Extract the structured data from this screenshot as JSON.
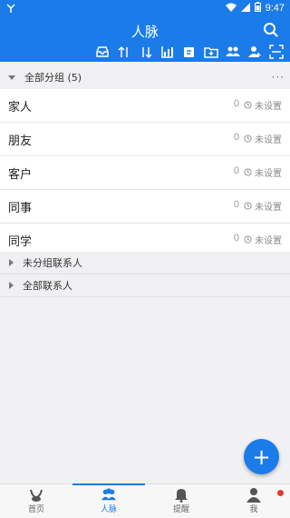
{
  "status_bar": {
    "time": "9:47",
    "signal_icon": "signal-icon",
    "wifi_icon": "wifi-icon",
    "battery_icon": "battery-icon"
  },
  "appbar": {
    "title": "人脉"
  },
  "tools": [
    {
      "name": "inbox-tool-icon"
    },
    {
      "name": "sort-up-tool-icon"
    },
    {
      "name": "sort-down-tool-icon"
    },
    {
      "name": "chart-tool-icon"
    },
    {
      "name": "edit-tool-icon"
    },
    {
      "name": "new-folder-tool-icon"
    },
    {
      "name": "group-tool-icon"
    },
    {
      "name": "add-contact-tool-icon"
    },
    {
      "name": "scan-tool-icon"
    }
  ],
  "group_header": {
    "label": "全部分组 (5)",
    "more": "···"
  },
  "groups": [
    {
      "name": "家人",
      "count": "0",
      "status": "未设置"
    },
    {
      "name": "朋友",
      "count": "0",
      "status": "未设置"
    },
    {
      "name": "客户",
      "count": "0",
      "status": "未设置"
    },
    {
      "name": "同事",
      "count": "0",
      "status": "未设置"
    },
    {
      "name": "同学",
      "count": "0",
      "status": "未设置"
    }
  ],
  "sections": [
    {
      "label": "未分组联系人"
    },
    {
      "label": "全部联系人"
    }
  ],
  "fab": {
    "label": "+"
  },
  "tabs": [
    {
      "label": "首页"
    },
    {
      "label": "人脉"
    },
    {
      "label": "提醒"
    },
    {
      "label": "我"
    }
  ],
  "colors": {
    "primary": "#1b7be8",
    "badge": "#e53935"
  }
}
